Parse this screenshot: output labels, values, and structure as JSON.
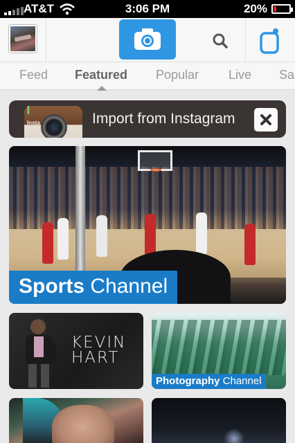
{
  "status_bar": {
    "carrier": "AT&T",
    "time": "3:06 PM",
    "battery_percent": "20%",
    "battery_level": 0.2,
    "battery_color": "#e02020"
  },
  "toolbar": {
    "accent_color": "#2f96e3",
    "icons": [
      "avatar",
      "camera-icon",
      "search-icon",
      "compose-icon"
    ]
  },
  "tabs": {
    "items": [
      "Feed",
      "Featured",
      "Popular",
      "Live",
      "Sa"
    ],
    "active": "Featured"
  },
  "import_banner": {
    "label": "Import from Instagram",
    "icon_caption": "Insta"
  },
  "channels": {
    "sports": {
      "name_bold": "Sports",
      "name_rest": " Channel"
    },
    "kevin": {
      "line1": "KEVIN",
      "line2": "HART"
    },
    "photography": {
      "name_bold": "Photography",
      "name_rest": " Channel"
    }
  },
  "label_color": "#1a7cc7"
}
